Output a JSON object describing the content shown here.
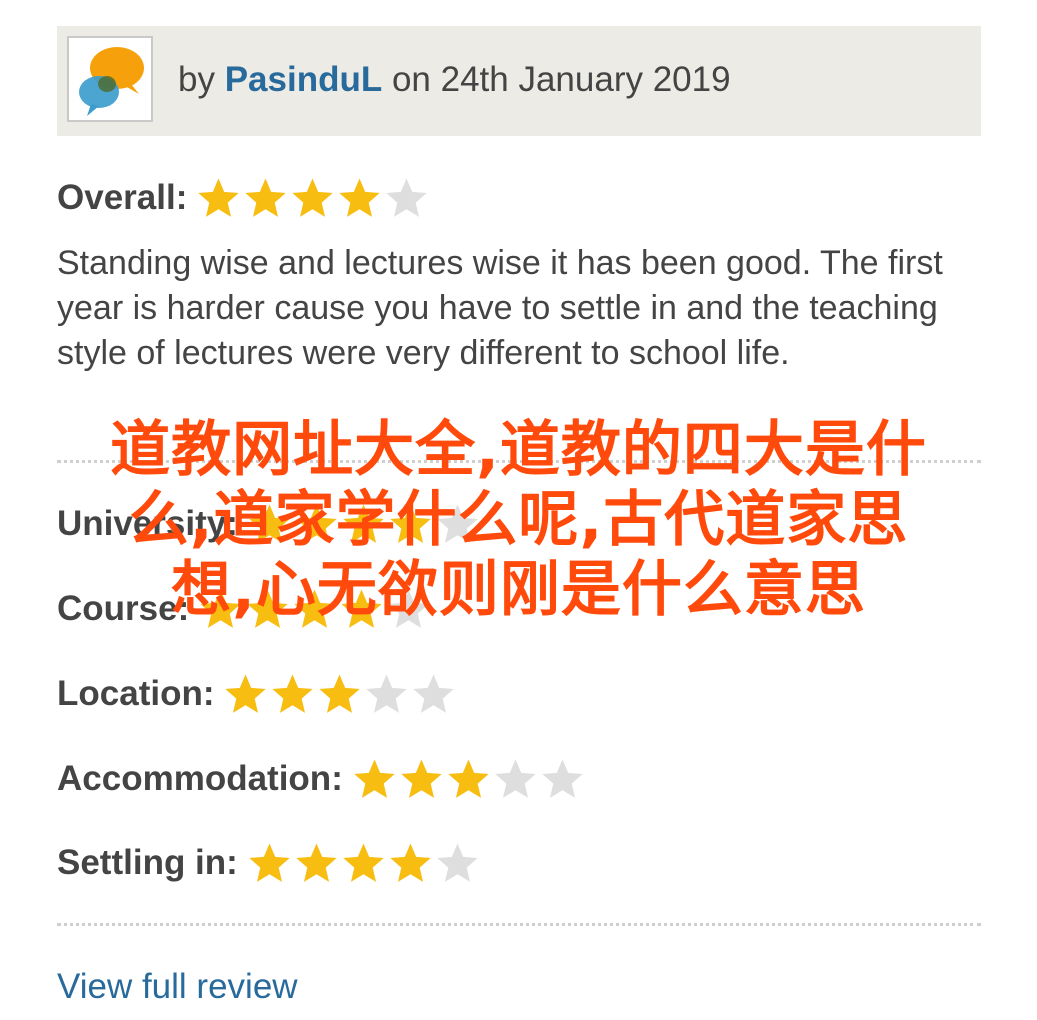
{
  "review": {
    "by_prefix": "by",
    "author": "PasinduL",
    "date_text": "on 24th January 2019",
    "overall": {
      "label": "Overall:",
      "stars": 4,
      "max": 5
    },
    "text": "Standing wise and lectures wise it has been good. The first year is harder cause you have to settle in and the teaching style of lectures were very different to school life.",
    "sub_ratings": [
      {
        "label": "University:",
        "stars": 4,
        "max": 5
      },
      {
        "label": "Course:",
        "stars": 4,
        "max": 5
      },
      {
        "label": "Location:",
        "stars": 3,
        "max": 5
      },
      {
        "label": "Accommodation:",
        "stars": 3,
        "max": 5
      },
      {
        "label": "Settling in:",
        "stars": 4,
        "max": 5
      }
    ],
    "view_full_review": "View full review"
  },
  "overlay": {
    "lines": [
      "道教网址大全,道教的四大是什",
      "么,道家学什么呢,古代道家思",
      "想,心无欲则刚是什么意思"
    ]
  },
  "colors": {
    "author_link": "#276a9b",
    "star_on": "#f7bd11",
    "star_off": "#dedede",
    "header_bg": "#ecebe5",
    "overlay_text": "#ff4a0b"
  },
  "icons": {
    "avatar": "speech-bubbles-logo",
    "star": "star-icon"
  }
}
